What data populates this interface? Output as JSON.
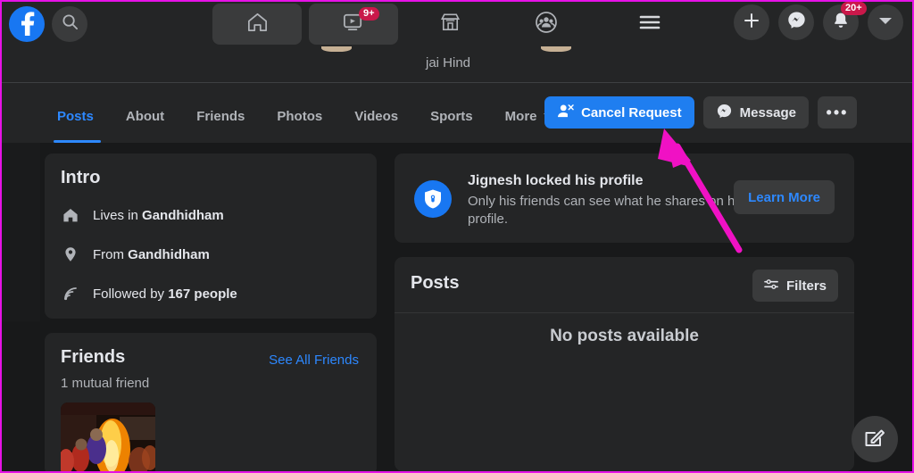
{
  "topnav": {
    "logo_label": "f",
    "logo_name": "facebook-logo",
    "search_placeholder": "Search Facebook",
    "tabs": [
      {
        "name": "home",
        "icon": "home-icon",
        "active": true,
        "badge": ""
      },
      {
        "name": "video",
        "icon": "video-icon",
        "active": true,
        "badge": "9+"
      },
      {
        "name": "marketplace",
        "icon": "marketplace-icon",
        "active": false,
        "badge": ""
      },
      {
        "name": "groups",
        "icon": "groups-icon",
        "active": false,
        "badge": ""
      }
    ],
    "menu_icon": "hamburger-menu-icon",
    "right_buttons": [
      {
        "name": "create",
        "icon": "plus-icon",
        "badge": ""
      },
      {
        "name": "messenger",
        "icon": "messenger-icon",
        "badge": ""
      },
      {
        "name": "notifications",
        "icon": "bell-icon",
        "badge": "20+"
      },
      {
        "name": "account",
        "icon": "chevron-down-icon",
        "badge": ""
      }
    ]
  },
  "profile": {
    "bio": "jai Hind",
    "tabs": [
      {
        "label": "Posts",
        "active": true
      },
      {
        "label": "About",
        "active": false
      },
      {
        "label": "Friends",
        "active": false
      },
      {
        "label": "Photos",
        "active": false
      },
      {
        "label": "Videos",
        "active": false
      },
      {
        "label": "Sports",
        "active": false
      },
      {
        "label": "More",
        "active": false,
        "has_caret": true
      }
    ],
    "actions": {
      "cancel_request": "Cancel Request",
      "message": "Message",
      "more": "•••"
    }
  },
  "intro": {
    "title": "Intro",
    "rows": [
      {
        "icon": "home-icon",
        "prefix": "Lives in ",
        "value": "Gandhidham"
      },
      {
        "icon": "location-pin-icon",
        "prefix": "From ",
        "value": "Gandhidham"
      },
      {
        "icon": "rss-follow-icon",
        "prefix": "Followed by ",
        "value": "167 people"
      }
    ]
  },
  "friends": {
    "title": "Friends",
    "see_all": "See All Friends",
    "mutual": "1 mutual friend",
    "thumbnail_name": "friend-photo-thumbnail"
  },
  "locked": {
    "icon": "shield-lock-icon",
    "title": "Jignesh locked his profile",
    "subtitle": "Only his friends can see what he shares on his profile.",
    "learn_more": "Learn More"
  },
  "posts": {
    "title": "Posts",
    "filters_label": "Filters",
    "empty_text": "No posts available"
  },
  "fab": {
    "name": "compose-post-button",
    "icon": "compose-edit-icon"
  },
  "annotation": {
    "type": "arrow",
    "color": "#f011c4",
    "points_to": "cancel-request-button"
  },
  "colors": {
    "page_bg": "#18191a",
    "card_bg": "#242526",
    "accent_blue": "#1f7ef0",
    "link_blue": "#2d88ff",
    "badge_red": "#c9184a",
    "annotation_magenta": "#f011c4",
    "text_primary": "#e4e6eb",
    "text_secondary": "#b0b3b8"
  }
}
